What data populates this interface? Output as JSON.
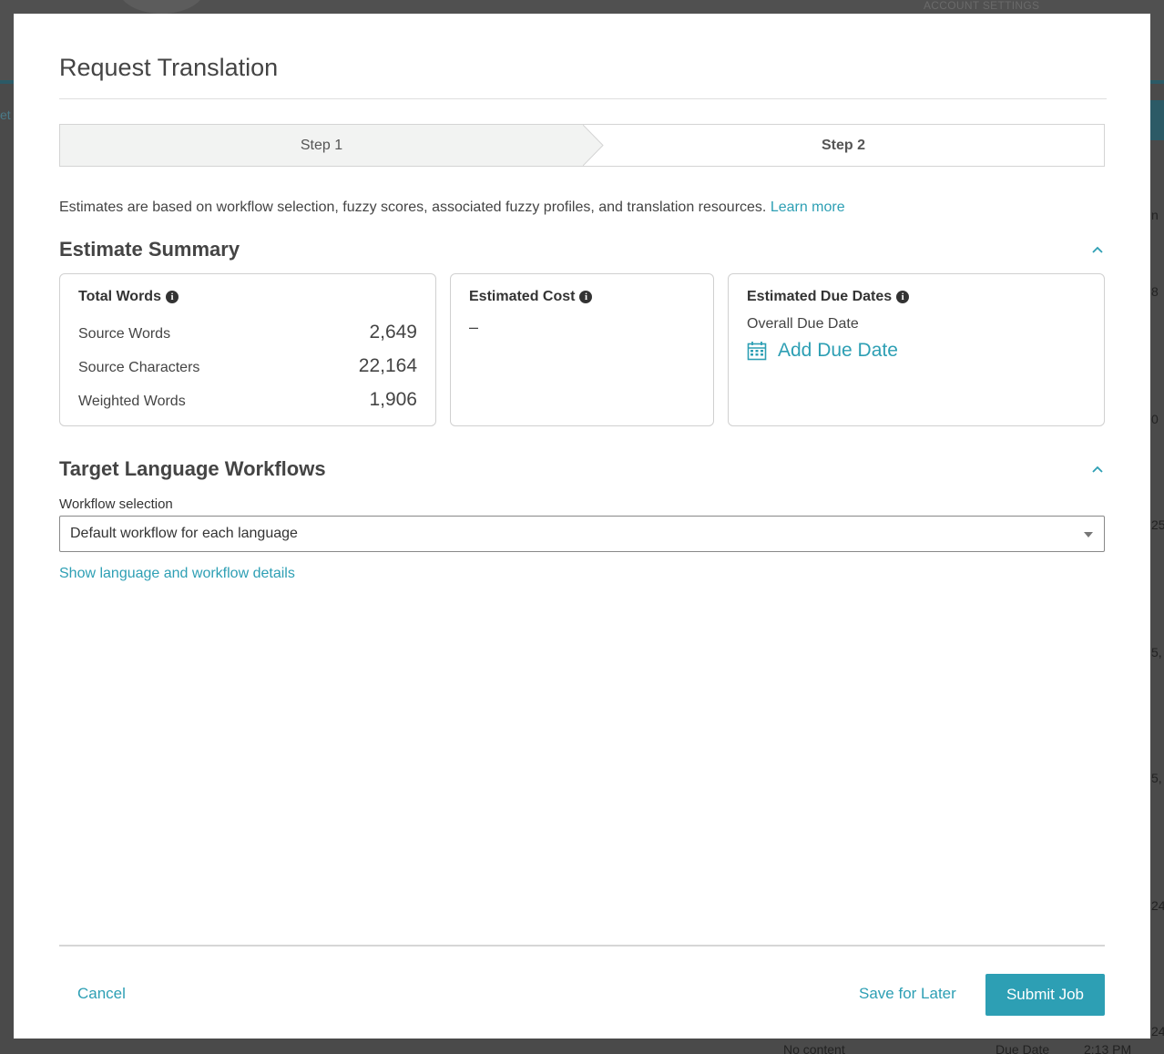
{
  "background": {
    "account_settings": "ACCOUNT SETTINGS",
    "left_tab": "et",
    "edge_fragments": [
      "n",
      "8",
      "0",
      "25",
      "5,",
      "5,",
      "24",
      "24"
    ],
    "bottom_fragments": [
      "No content",
      "Due Date",
      "2:13 PM"
    ]
  },
  "modal": {
    "title": "Request Translation",
    "steps": {
      "step1": "Step 1",
      "step2": "Step 2"
    },
    "estimate_note": "Estimates are based on workflow selection, fuzzy scores, associated fuzzy profiles, and translation resources.",
    "learn_more": "Learn more",
    "estimate_summary": {
      "title": "Estimate Summary",
      "total_words": {
        "title": "Total Words",
        "rows": [
          {
            "label": "Source Words",
            "value": "2,649"
          },
          {
            "label": "Source Characters",
            "value": "22,164"
          },
          {
            "label": "Weighted Words",
            "value": "1,906"
          }
        ]
      },
      "estimated_cost": {
        "title": "Estimated Cost",
        "value": "–"
      },
      "estimated_due_dates": {
        "title": "Estimated Due Dates",
        "overall_label": "Overall Due Date",
        "add_due_date": "Add Due Date"
      }
    },
    "target_language_workflows": {
      "title": "Target Language Workflows",
      "workflow_label": "Workflow selection",
      "workflow_value": "Default workflow for each language",
      "show_details": "Show language and workflow details"
    },
    "footer": {
      "cancel": "Cancel",
      "save_for_later": "Save for Later",
      "submit": "Submit Job"
    }
  },
  "colors": {
    "accent": "#2d9fb4",
    "overlay": "#3d3d3d"
  }
}
